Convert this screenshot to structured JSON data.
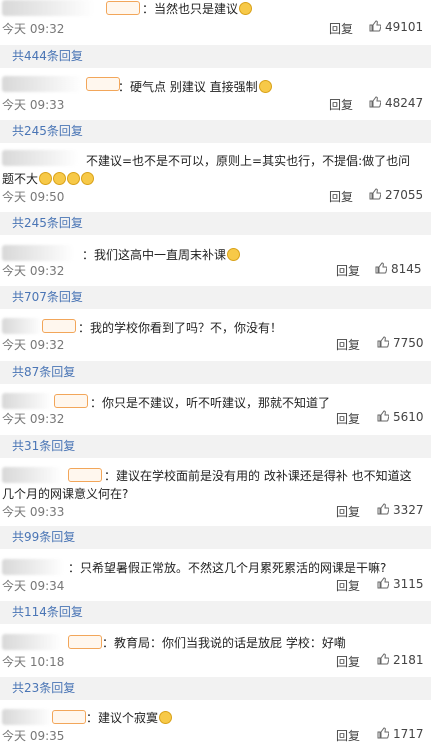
{
  "labels": {
    "reply": "回复"
  },
  "comments": [
    {
      "text": "：当然也只是建议",
      "time": "今天 09:32",
      "likes": "49101",
      "more": "共444条回复"
    },
    {
      "text": "：硬气点 别建议 直接强制",
      "time": "今天 09:33",
      "likes": "48247",
      "more": "共245条回复"
    },
    {
      "text": "不建议=也不是不可以，原则上=其实也行，不提倡:做了也问题不大",
      "time": "今天 09:50",
      "likes": "27055",
      "more": "共245条回复"
    },
    {
      "text": "：我们这高中一直周末补课",
      "time": "今天 09:32",
      "likes": "8145",
      "more": "共707条回复"
    },
    {
      "text": "：我的学校你看到了吗？不，你没有！",
      "time": "今天 09:32",
      "likes": "7750",
      "more": "共87条回复"
    },
    {
      "text": "：你只是不建议，听不听建议，那就不知道了",
      "time": "今天 09:32",
      "likes": "5610",
      "more": "共31条回复"
    },
    {
      "text": "：建议在学校面前是没有用的 改补课还是得补 也不知道这几个月的网课意义何在?",
      "time": "今天 09:33",
      "likes": "3327",
      "more": "共99条回复"
    },
    {
      "text": "：只希望暑假正常放。不然这几个月累死累活的网课是干嘛?",
      "time": "今天 09:34",
      "likes": "3115",
      "more": "共114条回复"
    },
    {
      "text": "：教育局：你们当我说的话是放屁 学校：好嘞",
      "time": "今天 10:18",
      "likes": "2181",
      "more": "共23条回复"
    },
    {
      "text": "：建议个寂寞",
      "time": "今天 09:35",
      "likes": "1717",
      "more": ""
    }
  ],
  "icons": {
    "like": "thumbs-up-icon",
    "emoji": "emoji-face-icon",
    "badge": "user-badge-icon"
  },
  "colors": {
    "link": "#4a75b5",
    "more_bg": "#f2f2f2",
    "badge": "#f2a65a"
  }
}
